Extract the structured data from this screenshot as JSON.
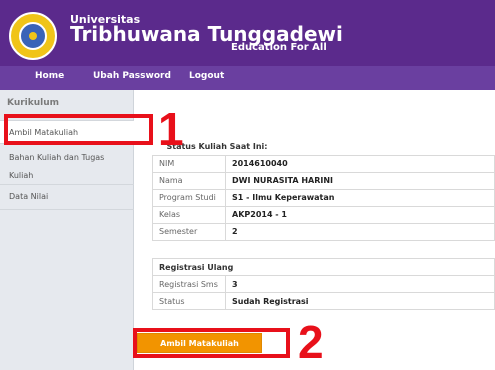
{
  "header": {
    "univ_label": "Universitas",
    "univ_name": "Tribhuwana Tunggadewi",
    "tagline": "Education For All"
  },
  "nav": {
    "items": [
      "Home",
      "Ubah Password",
      "Logout"
    ]
  },
  "sidebar": {
    "title": "Kurikulum",
    "items": [
      "Ambil Matakuliah",
      "Bahan Kuliah dan Tugas",
      "Kuliah",
      "Data Nilai"
    ]
  },
  "status": {
    "heading": "Status Kuliah Saat Ini:",
    "rows": [
      {
        "label": "NIM",
        "value": "2014610040"
      },
      {
        "label": "Nama",
        "value": "DWI NURASITA HARINI"
      },
      {
        "label": "Program Studi",
        "value": "S1 - Ilmu Keperawatan"
      },
      {
        "label": "Kelas",
        "value": "AKP2014 - 1"
      },
      {
        "label": "Semester",
        "value": "2"
      }
    ]
  },
  "registrasi": {
    "heading": "Registrasi Ulang",
    "rows": [
      {
        "label": "Registrasi Sms",
        "value": "3"
      },
      {
        "label": "Status",
        "value": "Sudah Registrasi"
      }
    ]
  },
  "action": {
    "button": "Ambil Matakuliah"
  },
  "annotations": {
    "step1": "1",
    "step2": "2",
    "color": "#e8101a"
  },
  "colors": {
    "header": "#5b2a8c",
    "nav": "#6a3fa0",
    "button": "#f29400"
  }
}
